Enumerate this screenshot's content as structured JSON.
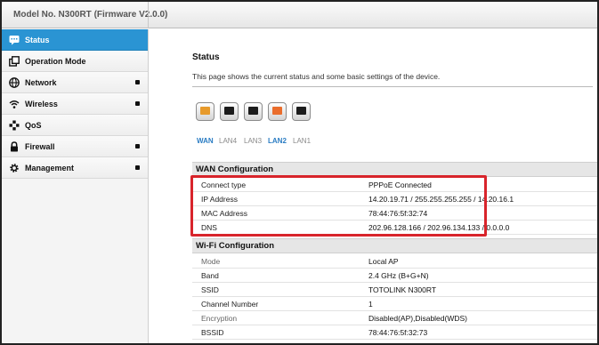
{
  "header": {
    "model": "Model No. N300RT (Firmware V2.0.0)"
  },
  "sidebar": {
    "items": [
      {
        "label": "Status",
        "icon": "status-chat-icon"
      },
      {
        "label": "Operation Mode",
        "icon": "window-icon"
      },
      {
        "label": "Network",
        "icon": "globe-icon"
      },
      {
        "label": "Wireless",
        "icon": "wifi-icon"
      },
      {
        "label": "QoS",
        "icon": "qos-icon"
      },
      {
        "label": "Firewall",
        "icon": "lock-icon"
      },
      {
        "label": "Management",
        "icon": "gear-icon"
      }
    ]
  },
  "main": {
    "title": "Status",
    "description": "This page shows the current status and some basic settings of the device.",
    "ports": [
      "WAN",
      "LAN4",
      "LAN3",
      "LAN2",
      "LAN1"
    ],
    "wan": {
      "title": "WAN Configuration",
      "rows": [
        {
          "key": "Connect type",
          "value": "PPPoE Connected"
        },
        {
          "key": "IP Address",
          "value": "14.20.19.71 / 255.255.255.255 / 14.20.16.1"
        },
        {
          "key": "MAC Address",
          "value": "78:44:76:5f:32:74"
        },
        {
          "key": "DNS",
          "value": "202.96.128.166 / 202.96.134.133 / 0.0.0.0"
        }
      ]
    },
    "wifi": {
      "title": "Wi-Fi Configuration",
      "rows": [
        {
          "key": "Mode",
          "value": "Local AP"
        },
        {
          "key": "Band",
          "value": "2.4 GHz (B+G+N)"
        },
        {
          "key": "SSID",
          "value": "TOTOLINK N300RT"
        },
        {
          "key": "Channel Number",
          "value": "1"
        },
        {
          "key": "Encryption",
          "value": "Disabled(AP),Disabled(WDS)"
        },
        {
          "key": "BSSID",
          "value": "78:44:76:5f:32:73"
        }
      ]
    }
  },
  "colors": {
    "accent": "#2a94d3",
    "highlight": "#d8242b",
    "port_active": "#e79a2b",
    "port_warn": "#ea6d2c"
  }
}
